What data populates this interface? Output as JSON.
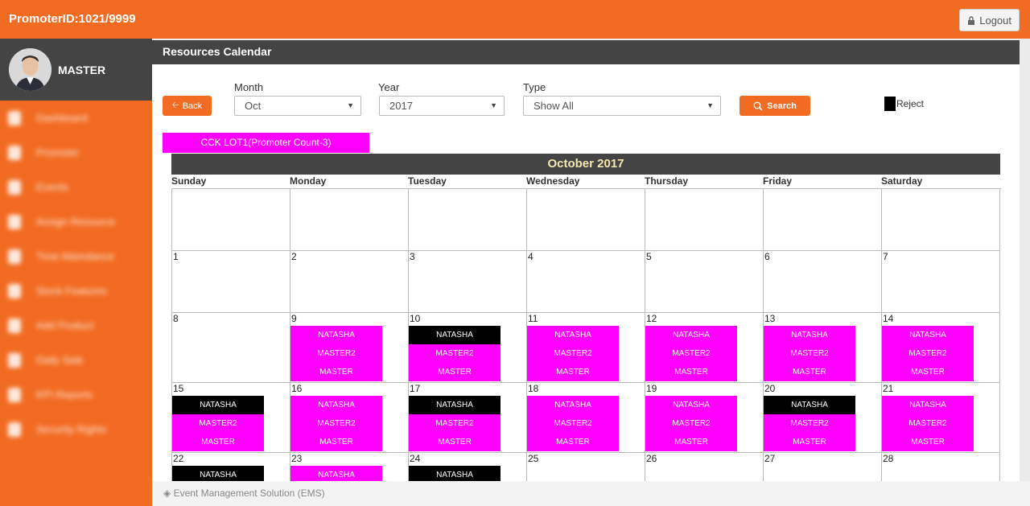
{
  "topbar": {
    "promoter_id": "PromoterID:1021/9999",
    "logout_label": "Logout"
  },
  "sidebar": {
    "user_name": "MASTER",
    "menu": [
      "Dashboard",
      "Promoter",
      "Events",
      "Assign Resource",
      "Time Attendance",
      "Stock Features",
      "Add Product",
      "Daily Sale",
      "KPI Reports",
      "Security Rights"
    ]
  },
  "page": {
    "title": "Resources Calendar",
    "back_label": "Back"
  },
  "filters": {
    "month_label": "Month",
    "month_value": "Oct",
    "year_label": "Year",
    "year_value": "2017",
    "type_label": "Type",
    "type_value": "Show All",
    "search_label": "Search"
  },
  "legend": {
    "reject_label": "Reject",
    "reject_color": "#000000"
  },
  "group_tab": "CCK LOT1(Promoter Count-3)",
  "calendar": {
    "title": "October 2017",
    "day_names": [
      "Sunday",
      "Monday",
      "Tuesday",
      "Wednesday",
      "Thursday",
      "Friday",
      "Saturday"
    ],
    "colors": {
      "assigned": "#ff00ff",
      "reject": "#000000"
    },
    "weeks": [
      [
        {
          "day": ""
        },
        {
          "day": ""
        },
        {
          "day": ""
        },
        {
          "day": ""
        },
        {
          "day": ""
        },
        {
          "day": ""
        },
        {
          "day": ""
        }
      ],
      [
        {
          "day": "1"
        },
        {
          "day": "2"
        },
        {
          "day": "3"
        },
        {
          "day": "4"
        },
        {
          "day": "5"
        },
        {
          "day": "6"
        },
        {
          "day": "7"
        }
      ],
      [
        {
          "day": "8"
        },
        {
          "day": "9",
          "events": [
            {
              "name": "NATASHA",
              "status": "assigned"
            },
            {
              "name": "MASTER2",
              "status": "assigned"
            },
            {
              "name": "MASTER",
              "status": "assigned"
            }
          ]
        },
        {
          "day": "10",
          "events": [
            {
              "name": "NATASHA",
              "status": "reject"
            },
            {
              "name": "MASTER2",
              "status": "assigned"
            },
            {
              "name": "MASTER",
              "status": "assigned"
            }
          ]
        },
        {
          "day": "11",
          "events": [
            {
              "name": "NATASHA",
              "status": "assigned"
            },
            {
              "name": "MASTER2",
              "status": "assigned"
            },
            {
              "name": "MASTER",
              "status": "assigned"
            }
          ]
        },
        {
          "day": "12",
          "events": [
            {
              "name": "NATASHA",
              "status": "assigned"
            },
            {
              "name": "MASTER2",
              "status": "assigned"
            },
            {
              "name": "MASTER",
              "status": "assigned"
            }
          ]
        },
        {
          "day": "13",
          "events": [
            {
              "name": "NATASHA",
              "status": "assigned"
            },
            {
              "name": "MASTER2",
              "status": "assigned"
            },
            {
              "name": "MASTER",
              "status": "assigned"
            }
          ]
        },
        {
          "day": "14",
          "events": [
            {
              "name": "NATASHA",
              "status": "assigned"
            },
            {
              "name": "MASTER2",
              "status": "assigned"
            },
            {
              "name": "MASTER",
              "status": "assigned"
            }
          ]
        }
      ],
      [
        {
          "day": "15",
          "events": [
            {
              "name": "NATASHA",
              "status": "reject"
            },
            {
              "name": "MASTER2",
              "status": "assigned"
            },
            {
              "name": "MASTER",
              "status": "assigned"
            }
          ]
        },
        {
          "day": "16",
          "events": [
            {
              "name": "NATASHA",
              "status": "assigned"
            },
            {
              "name": "MASTER2",
              "status": "assigned"
            },
            {
              "name": "MASTER",
              "status": "assigned"
            }
          ]
        },
        {
          "day": "17",
          "events": [
            {
              "name": "NATASHA",
              "status": "reject"
            },
            {
              "name": "MASTER2",
              "status": "assigned"
            },
            {
              "name": "MASTER",
              "status": "assigned"
            }
          ]
        },
        {
          "day": "18",
          "events": [
            {
              "name": "NATASHA",
              "status": "assigned"
            },
            {
              "name": "MASTER2",
              "status": "assigned"
            },
            {
              "name": "MASTER",
              "status": "assigned"
            }
          ]
        },
        {
          "day": "19",
          "events": [
            {
              "name": "NATASHA",
              "status": "assigned"
            },
            {
              "name": "MASTER2",
              "status": "assigned"
            },
            {
              "name": "MASTER",
              "status": "assigned"
            }
          ]
        },
        {
          "day": "20",
          "events": [
            {
              "name": "NATASHA",
              "status": "reject"
            },
            {
              "name": "MASTER2",
              "status": "assigned"
            },
            {
              "name": "MASTER",
              "status": "assigned"
            }
          ]
        },
        {
          "day": "21",
          "events": [
            {
              "name": "NATASHA",
              "status": "assigned"
            },
            {
              "name": "MASTER2",
              "status": "assigned"
            },
            {
              "name": "MASTER",
              "status": "assigned"
            }
          ]
        }
      ],
      [
        {
          "day": "22",
          "events": [
            {
              "name": "NATASHA",
              "status": "reject"
            }
          ]
        },
        {
          "day": "23",
          "events": [
            {
              "name": "NATASHA",
              "status": "assigned"
            }
          ]
        },
        {
          "day": "24",
          "events": [
            {
              "name": "NATASHA",
              "status": "reject"
            }
          ]
        },
        {
          "day": "25"
        },
        {
          "day": "26"
        },
        {
          "day": "27"
        },
        {
          "day": "28"
        }
      ]
    ]
  },
  "footer": "Event Management Solution (EMS)"
}
